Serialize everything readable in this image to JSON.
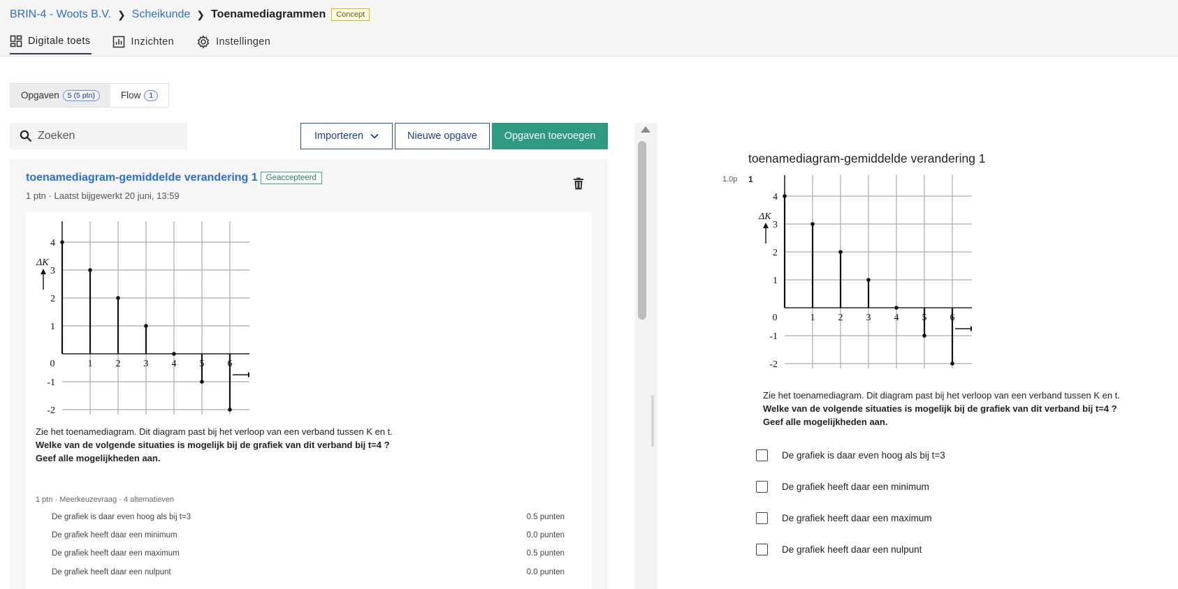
{
  "breadcrumb": {
    "items": [
      "BRIN-4 - Woots B.V.",
      "Scheikunde"
    ],
    "current": "Toenamediagrammen",
    "badge": "Concept"
  },
  "nav": {
    "tabs": [
      {
        "label": "Digitale toets",
        "icon": "dashboard-icon",
        "active": true
      },
      {
        "label": "Inzichten",
        "icon": "chart-icon",
        "active": false
      },
      {
        "label": "Instellingen",
        "icon": "gear-icon",
        "active": false
      }
    ]
  },
  "segments": [
    {
      "label": "Opgaven",
      "count": "5 (5 ptn)",
      "active": true
    },
    {
      "label": "Flow",
      "count": "1",
      "active": false
    }
  ],
  "search": {
    "placeholder": "Zoeken"
  },
  "toolbar": {
    "import_label": "Importeren",
    "new_label": "Nieuwe opgave",
    "add_label": "Opgaven toevoegen"
  },
  "question": {
    "title": "toenamediagram-gemiddelde verandering 1",
    "status": "Geaccepteerd",
    "meta": "1 ptn · Laatst bijgewerkt 20 juni, 13:59",
    "stem_plain": "Zie het toenamediagram. Dit diagram past bij het verloop van een verband tussen K en t.",
    "stem_bold_1": "Welke van de volgende situaties is mogelijk bij de grafiek van dit verband bij t=4 ?",
    "stem_bold_2": "Geef alle mogelijkheden aan.",
    "alt_meta": "1 ptn · Meerkeuzevraag · 4 alternatieven",
    "alternatives": [
      {
        "text": "De grafiek is daar even hoog als bij t=3",
        "points": "0.5 punten"
      },
      {
        "text": "De grafiek heeft daar een minimum",
        "points": "0.0 punten"
      },
      {
        "text": "De grafiek heeft daar een maximum",
        "points": "0.5 punten"
      },
      {
        "text": "De grafiek heeft daar een nulpunt",
        "points": "0.0 punten"
      }
    ]
  },
  "preview": {
    "title": "toenamediagram-gemiddelde verandering 1",
    "points": "1.0p",
    "number": "1"
  },
  "chart_data": {
    "type": "bar",
    "xlabel": "t",
    "ylabel": "ΔK",
    "x": [
      0,
      1,
      2,
      3,
      4,
      5,
      6
    ],
    "values": [
      4,
      3,
      2,
      1,
      0,
      -1,
      -2
    ],
    "xlim": [
      0,
      7
    ],
    "ylim": [
      -2.5,
      4.5
    ],
    "x_ticks": [
      "0",
      "1",
      "2",
      "3",
      "4",
      "5",
      "6"
    ],
    "y_ticks": [
      "-2",
      "-1",
      "1",
      "2",
      "3",
      "4"
    ],
    "grid": true
  },
  "colors": {
    "link": "#2a6fd6",
    "primary": "#2e9b80",
    "outline": "#2a4f9c",
    "concept": "#e5b800",
    "accepted": "#3aa886"
  }
}
